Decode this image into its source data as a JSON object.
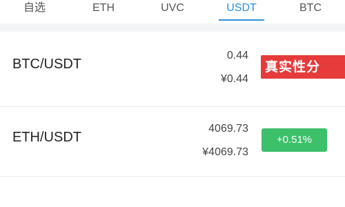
{
  "tabs": [
    {
      "label": "自选",
      "active": false
    },
    {
      "label": "ETH",
      "active": false
    },
    {
      "label": "UVC",
      "active": false
    },
    {
      "label": "USDT",
      "active": true
    },
    {
      "label": "BTC",
      "active": false
    }
  ],
  "rows": [
    {
      "pair": "BTC/USDT",
      "price": "0.44",
      "cny": "¥0.44",
      "change": "真实性分"
    },
    {
      "pair": "ETH/USDT",
      "price": "4069.73",
      "cny": "¥4069.73",
      "change": "+0.51%"
    }
  ],
  "colors": {
    "accent": "#2f8fd8",
    "up": "#3cc06a",
    "red": "#e53b3b"
  }
}
